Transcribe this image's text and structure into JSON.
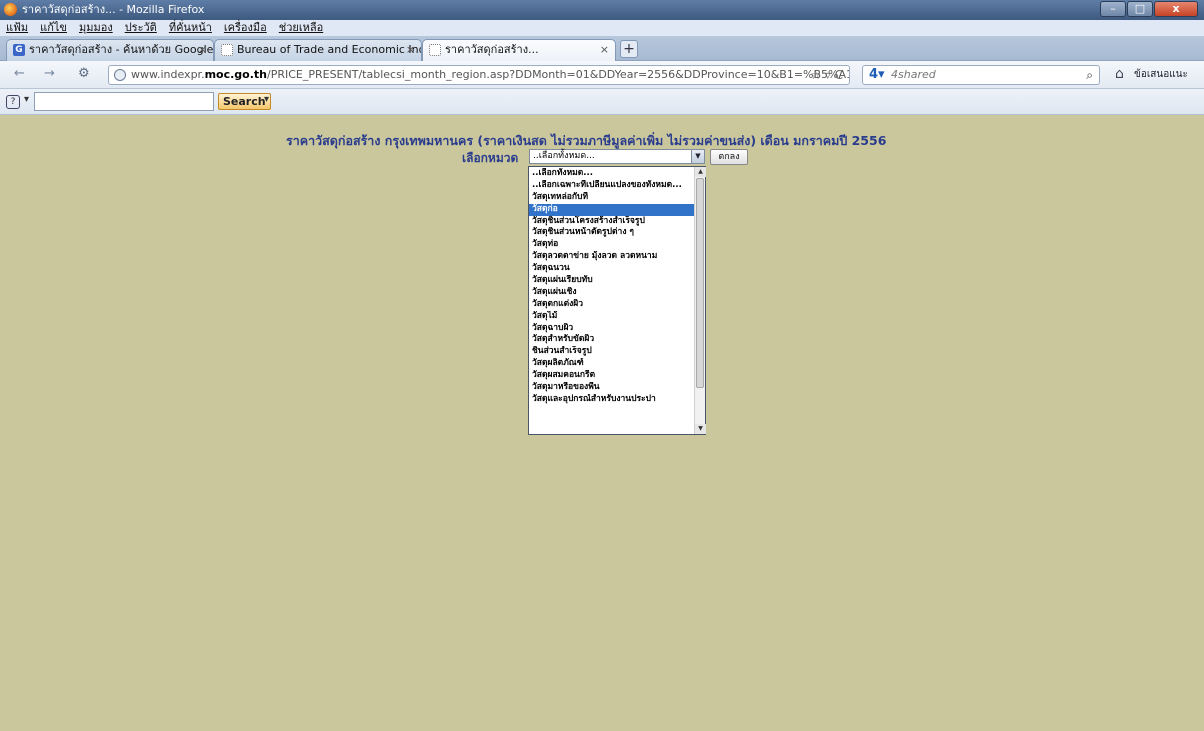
{
  "window": {
    "title": "ราคาวัสดุก่อสร้าง... - Mozilla Firefox",
    "controls": [
      "–",
      "□",
      "x"
    ]
  },
  "menu": [
    "แฟ้ม",
    "แก้ไข",
    "มุมมอง",
    "ประวัติ",
    "ที่คั่นหน้า",
    "เครื่องมือ",
    "ช่วยเหลือ"
  ],
  "tabs": [
    {
      "label": "ราคาวัสดุก่อสร้าง - ค้นหาด้วย Google",
      "icon": "google-icon"
    },
    {
      "label": "Bureau of Trade and Economic Indici...",
      "icon": "page-icon"
    },
    {
      "label": "ราคาวัสดุก่อสร้าง...",
      "icon": "page-icon",
      "active": true
    }
  ],
  "nav": {
    "url_prefix": "www.indexpr.",
    "url_domain": "moc.go.th",
    "url_path": "/PRICE_PRESENT/tablecsi_month_region.asp?DDMonth=01&DDYear=2556&DDProvince=10&B1=%B5%A1%C5%A7",
    "search_engine_name": "4shared",
    "suggest_label": "ข้อเสนอแนะ"
  },
  "toolbar": {
    "search_button": "Search"
  },
  "page": {
    "heading": "ราคาวัสดุก่อสร้าง กรุงเทพมหานคร (ราคาเงินสด ไม่รวมภาษีมูลค่าเพิ่ม ไม่รวมค่าขนส่ง) เดือน มกราคมปี 2556",
    "category_label": "เลือกหมวด",
    "select_value": "..เลือกทั้งหมด...",
    "ok_button": "ตกลง",
    "options": [
      "..เลือกทั้งหมด...",
      "..เลือกเฉพาะที่เปลี่ยนแปลงของทั้งหมด...",
      "วัสดุเทหล่อกับที่",
      "วัสดุก่อ",
      "วัสดุชิ้นส่วนโครงสร้างสำเร็จรูป",
      "วัสดุชิ้นส่วนหน้าตัดรูปต่าง ๆ",
      "วัสดุท่อ",
      "วัสดุลวดตาข่าย มุ้งลวด ลวดหนาม",
      "วัสดุฉนวน",
      "วัสดุแผ่นเรียบทับ",
      "วัสดุแผ่นเชิง",
      "วัสดุตกแต่งผิว",
      "วัสดุไม้",
      "วัสดุฉาบผิว",
      "วัสดุสำหรับขัดผิว",
      "ชิ้นส่วนสำเร็จรูป",
      "วัสดุผลิตภัณฑ์",
      "วัสดุผสมคอนกรีต",
      "วัสดุมาหรือของพื้น",
      "วัสดุและอุปกรณ์สำหรับงานประปา"
    ],
    "selected_index": 3
  }
}
